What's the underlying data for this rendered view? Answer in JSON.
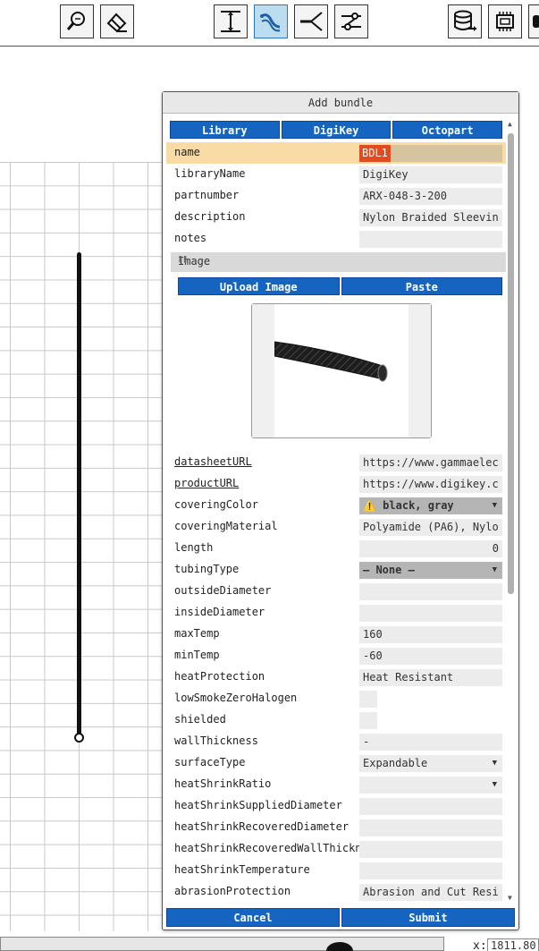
{
  "dialog": {
    "title": "Add bundle",
    "tabs": [
      "Library",
      "DigiKey",
      "Octopart"
    ],
    "image_section": {
      "label": "Image",
      "upload": "Upload Image",
      "paste": "Paste"
    },
    "fields": {
      "name": {
        "label": "name",
        "value": "BDL1"
      },
      "libraryName": {
        "label": "libraryName",
        "value": "DigiKey"
      },
      "partnumber": {
        "label": "partnumber",
        "value": "ARX-048-3-200"
      },
      "description": {
        "label": "description",
        "value": "Nylon Braided Sleevin"
      },
      "notes": {
        "label": "notes",
        "value": ""
      },
      "datasheetURL": {
        "label": "datasheetURL",
        "value": "https://www.gammaelec"
      },
      "productURL": {
        "label": "productURL",
        "value": "https://www.digikey.c"
      },
      "coveringColor": {
        "label": "coveringColor",
        "value": "⚠️ black, gray"
      },
      "coveringMaterial": {
        "label": "coveringMaterial",
        "value": "Polyamide (PA6), Nylo"
      },
      "length": {
        "label": "length",
        "value": "0"
      },
      "tubingType": {
        "label": "tubingType",
        "value": "— None —"
      },
      "outsideDiameter": {
        "label": "outsideDiameter",
        "value": ""
      },
      "insideDiameter": {
        "label": "insideDiameter",
        "value": ""
      },
      "maxTemp": {
        "label": "maxTemp",
        "value": "160"
      },
      "minTemp": {
        "label": "minTemp",
        "value": "-60"
      },
      "heatProtection": {
        "label": "heatProtection",
        "value": "Heat Resistant"
      },
      "lowSmokeZeroHalogen": {
        "label": "lowSmokeZeroHalogen"
      },
      "shielded": {
        "label": "shielded"
      },
      "wallThickness": {
        "label": "wallThickness",
        "value": "-"
      },
      "surfaceType": {
        "label": "surfaceType",
        "value": "Expandable"
      },
      "heatShrinkRatio": {
        "label": "heatShrinkRatio",
        "value": ""
      },
      "heatShrinkSuppliedDiameter": {
        "label": "heatShrinkSuppliedDiameter",
        "value": ""
      },
      "heatShrinkRecoveredDiameter": {
        "label": "heatShrinkRecoveredDiameter",
        "value": ""
      },
      "heatShrinkRecoveredWallThickness": {
        "label": "heatShrinkRecoveredWallThickn",
        "value": ""
      },
      "heatShrinkTemperature": {
        "label": "heatShrinkTemperature",
        "value": ""
      },
      "abrasionProtection": {
        "label": "abrasionProtection",
        "value": "Abrasion and Cut Resi"
      }
    },
    "cancel": "Cancel",
    "submit": "Submit"
  },
  "status": {
    "x_label": "x:",
    "x_value": "1811.80"
  },
  "colors": {
    "accent": "#1565c0",
    "highlight_row": "#f8dba5",
    "name_tag": "#e24b1f",
    "toolbar_active": "#bcdcf0"
  },
  "toolbar_icons": [
    "search-zoom-icon",
    "eraser-icon",
    "dimension-icon",
    "wire-tool-icon",
    "cutter-icon",
    "schematic-icon",
    "database-export-icon",
    "chip-icon"
  ]
}
